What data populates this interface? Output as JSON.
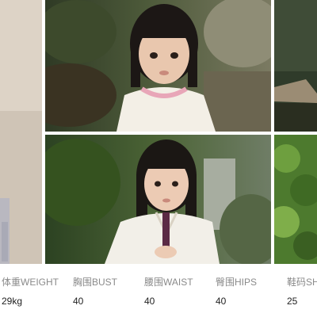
{
  "gallery": {
    "photos": [
      {
        "subject": "left-edge-cropped-photo"
      },
      {
        "subject": "child-in-white-top-outdoors"
      },
      {
        "subject": "child-in-white-hanfu-holding-lipstick"
      },
      {
        "subject": "right-edge-cropped-photo-top"
      },
      {
        "subject": "right-edge-cropped-photo-bottom"
      }
    ]
  },
  "measurements": [
    {
      "label": "体重WEIGHT",
      "value": "29kg"
    },
    {
      "label": "胸围BUST",
      "value": "40"
    },
    {
      "label": "腰围WAIST",
      "value": "40"
    },
    {
      "label": "臀围HIPS",
      "value": "40"
    },
    {
      "label": "鞋码SH",
      "value": "25"
    }
  ]
}
